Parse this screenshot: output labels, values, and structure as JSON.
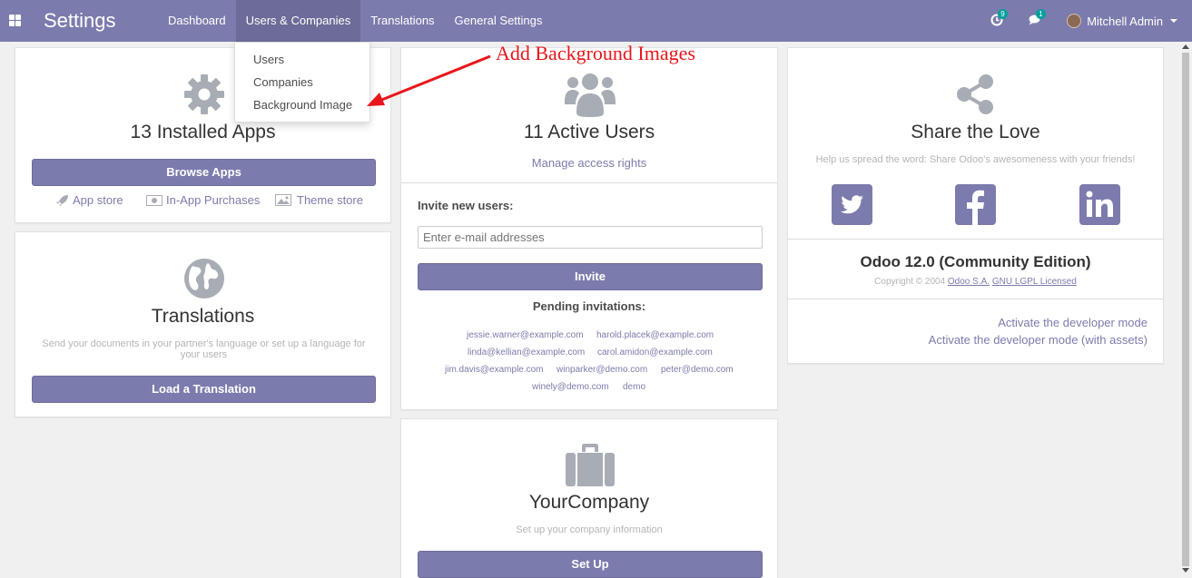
{
  "app": {
    "title": "Settings"
  },
  "nav": {
    "menu": [
      "Dashboard",
      "Users & Companies",
      "Translations",
      "General Settings"
    ],
    "activity_count": "9",
    "message_count": "1",
    "user_name": "Mitchell Admin"
  },
  "dropdown": {
    "items": [
      "Users",
      "Companies",
      "Background Image"
    ]
  },
  "annotation": "Add Background Images",
  "apps_card": {
    "title": "13 Installed Apps",
    "button": "Browse Apps",
    "links": [
      "App store",
      "In-App Purchases",
      "Theme store"
    ]
  },
  "translations_card": {
    "title": "Translations",
    "subtitle": "Send your documents in your partner's language or set up a language for your users",
    "button": "Load a Translation"
  },
  "users_card": {
    "title": "11 Active Users",
    "manage_link": "Manage access rights",
    "invite_label": "Invite new users:",
    "invite_placeholder": "Enter e-mail addresses",
    "invite_button": "Invite",
    "pending_label": "Pending invitations:",
    "pending": [
      "jessie.warner@example.com",
      "harold.placek@example.com",
      "linda@kellian@example.com",
      "carol.amidon@example.com",
      "jim.davis@example.com",
      "winparker@demo.com",
      "peter@demo.com",
      "winely@demo.com",
      "demo"
    ]
  },
  "company_card": {
    "title": "YourCompany",
    "subtitle": "Set up your company information",
    "button": "Set Up"
  },
  "share_card": {
    "title": "Share the Love",
    "subtitle": "Help us spread the word: Share Odoo's awesomeness with your friends!",
    "edition": "Odoo 12.0 (Community Edition)",
    "copyright": "Copyright © 2004",
    "company_link": "Odoo S.A.",
    "license_link": "GNU LGPL Licensed",
    "dev_mode": "Activate the developer mode",
    "dev_mode_assets": "Activate the developer mode (with assets)"
  },
  "colors": {
    "primary": "#7c7bad",
    "annotation": "#e8161b",
    "icon_gray": "#a8acb4"
  }
}
